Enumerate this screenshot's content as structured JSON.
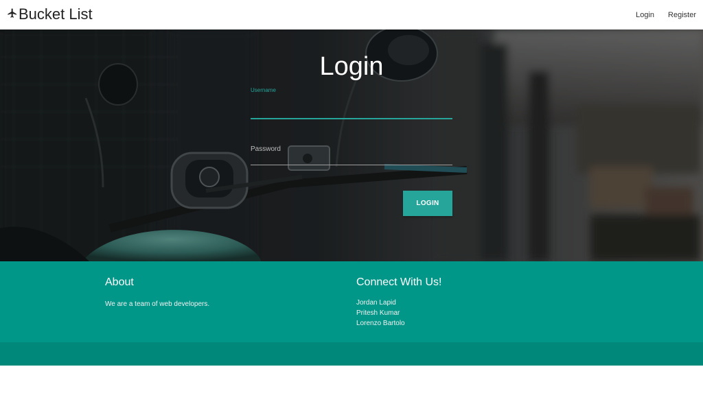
{
  "nav": {
    "brand": "Bucket List",
    "brand_icon": "airplane-icon",
    "links": [
      "Login",
      "Register"
    ]
  },
  "hero": {
    "title": "Login",
    "username_label": "Username",
    "password_placeholder": "Password",
    "login_button": "LOGIN"
  },
  "footer": {
    "about_heading": "About",
    "about_text": "We are a team of web developers.",
    "connect_heading": "Connect With Us!",
    "members": [
      "Jordan Lapid",
      "Pritesh Kumar",
      "Lorenzo Bartolo"
    ]
  },
  "colors": {
    "accent": "#26a69a",
    "footer": "#009688",
    "footer_copy": "#00897b"
  }
}
